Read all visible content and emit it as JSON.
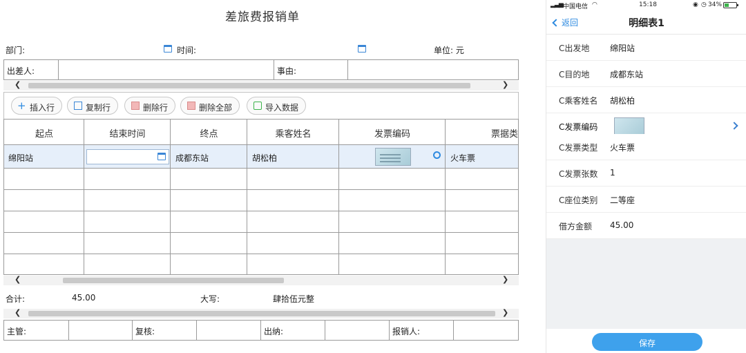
{
  "form": {
    "title": "差旅费报销单",
    "meta": {
      "dept_label": "部门:",
      "time_label": "时间:",
      "unit_label": "单位: 元"
    },
    "header": {
      "traveler_label": "出差人:",
      "reason_label": "事由:"
    },
    "toolbar": {
      "insert_row": "插入行",
      "copy_row": "复制行",
      "delete_row": "删除行",
      "delete_all": "删除全部",
      "import_data": "导入数据"
    },
    "table": {
      "columns": [
        "起点",
        "结束时间",
        "终点",
        "乘客姓名",
        "发票编码",
        "票据类型"
      ],
      "rows": [
        {
          "start": "绵阳站",
          "end_time": "",
          "end": "成都东站",
          "passenger": "胡松柏",
          "invoice_code": "",
          "ticket_type": "火车票"
        }
      ]
    },
    "totals": {
      "total_label": "合计:",
      "total_value": "45.00",
      "upper_label": "大写:",
      "upper_value": "肆拾伍元整"
    },
    "sign": {
      "supervisor": "主管:",
      "reviewer": "复核:",
      "cashier": "出纳:",
      "claimant": "报销人:"
    }
  },
  "phone": {
    "status": {
      "carrier": "中国电信",
      "time": "15:18",
      "battery": "34%"
    },
    "nav": {
      "back": "返回",
      "title": "明细表1"
    },
    "details": [
      {
        "key": "C出发地",
        "value": "绵阳站"
      },
      {
        "key": "C目的地",
        "value": "成都东站"
      },
      {
        "key": "C乘客姓名",
        "value": "胡松柏"
      },
      {
        "key": "C发票编码",
        "value": ""
      },
      {
        "key": "C发票类型",
        "value": "火车票"
      },
      {
        "key": "C发票张数",
        "value": "1"
      },
      {
        "key": "C座位类别",
        "value": "二等座"
      },
      {
        "key": "借方金额",
        "value": "45.00"
      }
    ],
    "save": "保存"
  },
  "colors": {
    "accent": "#3ea1ec",
    "selected_row": "#e6effa",
    "link": "#2d8ae0"
  }
}
